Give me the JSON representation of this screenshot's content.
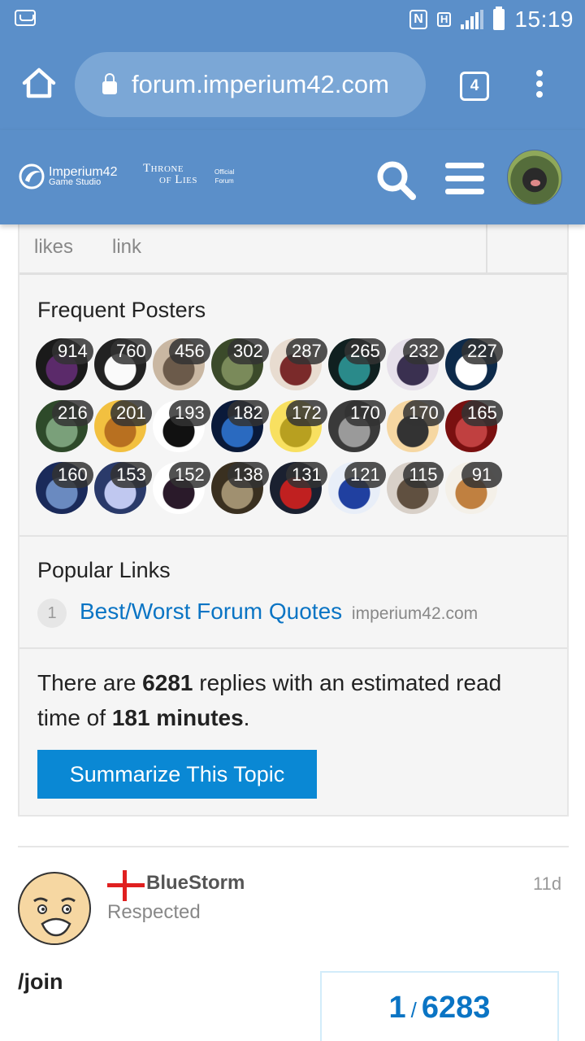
{
  "status_bar": {
    "time": "15:19",
    "icons": [
      "voicemail-icon",
      "nfc-icon",
      "hd-signal-icon",
      "cell-signal-icon",
      "battery-icon"
    ],
    "nfc_label": "N",
    "hd_label": "H"
  },
  "browser": {
    "url": "forum.imperium42.com",
    "tab_count": "4"
  },
  "forum_header": {
    "brand_name": "Imperium42",
    "brand_sub": "Game Studio",
    "game_title_1": "Throne",
    "game_title_2": "of Lies",
    "badge_1": "Official",
    "badge_2": "Forum"
  },
  "summary": {
    "stat_labels": [
      "likes",
      "link"
    ],
    "frequent_posters_title": "Frequent Posters",
    "poster_counts": [
      "914",
      "760",
      "456",
      "302",
      "287",
      "265",
      "232",
      "227",
      "216",
      "201",
      "193",
      "182",
      "172",
      "170",
      "170",
      "165",
      "160",
      "153",
      "152",
      "138",
      "131",
      "121",
      "115",
      "91"
    ],
    "popular_links_title": "Popular Links",
    "link": {
      "clicks": "1",
      "title": "Best/Worst Forum Quotes",
      "domain": "imperium42.com"
    },
    "replies_prefix": "There are ",
    "replies_count": "6281",
    "replies_middle": " replies with an estimated read time of ",
    "read_time": "181 minutes",
    "replies_suffix": ".",
    "summarize_button": "Summarize This Topic"
  },
  "post": {
    "username": "BlueStorm",
    "user_title": "Respected",
    "age": "11d",
    "content": "/join",
    "progress_current": "1",
    "progress_total": "6283"
  },
  "colors": {
    "header_blue": "#5b8fc9",
    "link_blue": "#0a74c4",
    "button_blue": "#0a88d4",
    "england_red": "#e02020"
  }
}
